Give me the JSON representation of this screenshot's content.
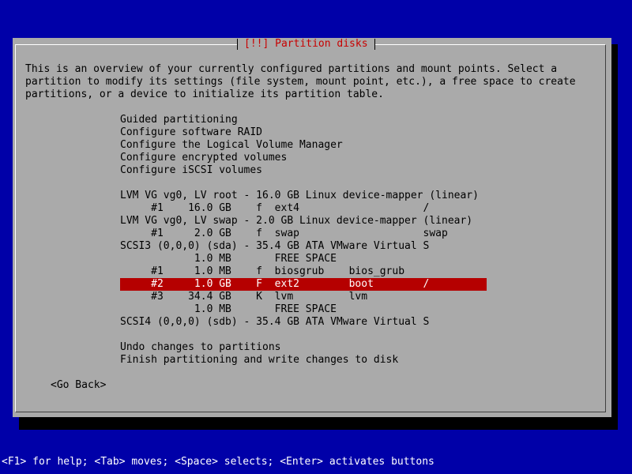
{
  "dialog": {
    "title": "[!!] Partition disks",
    "intro": "This is an overview of your currently configured partitions and mount points. Select a partition to modify its settings (file system, mount point, etc.), a free space to create partitions, or a device to initialize its partition table."
  },
  "menu": {
    "actions": [
      "Guided partitioning",
      "Configure software RAID",
      "Configure the Logical Volume Manager",
      "Configure encrypted volumes",
      "Configure iSCSI volumes"
    ],
    "partitions": [
      "LVM VG vg0, LV root - 16.0 GB Linux device-mapper (linear)",
      "     #1    16.0 GB    f  ext4                    /",
      "LVM VG vg0, LV swap - 2.0 GB Linux device-mapper (linear)",
      "     #1     2.0 GB    f  swap                    swap",
      "SCSI3 (0,0,0) (sda) - 35.4 GB ATA VMware Virtual S",
      "            1.0 MB       FREE SPACE",
      "     #1     1.0 MB    f  biosgrub    bios_grub",
      "     #2     1.0 GB    F  ext2        boot        /",
      "     #3    34.4 GB    K  lvm         lvm",
      "            1.0 MB       FREE SPACE",
      "SCSI4 (0,0,0) (sdb) - 35.4 GB ATA VMware Virtual S"
    ],
    "finish": [
      "Undo changes to partitions",
      "Finish partitioning and write changes to disk"
    ]
  },
  "buttons": {
    "go_back": "<Go Back>"
  },
  "help_bar": "<F1> for help; <Tab> moves; <Space> selects; <Enter> activates buttons"
}
